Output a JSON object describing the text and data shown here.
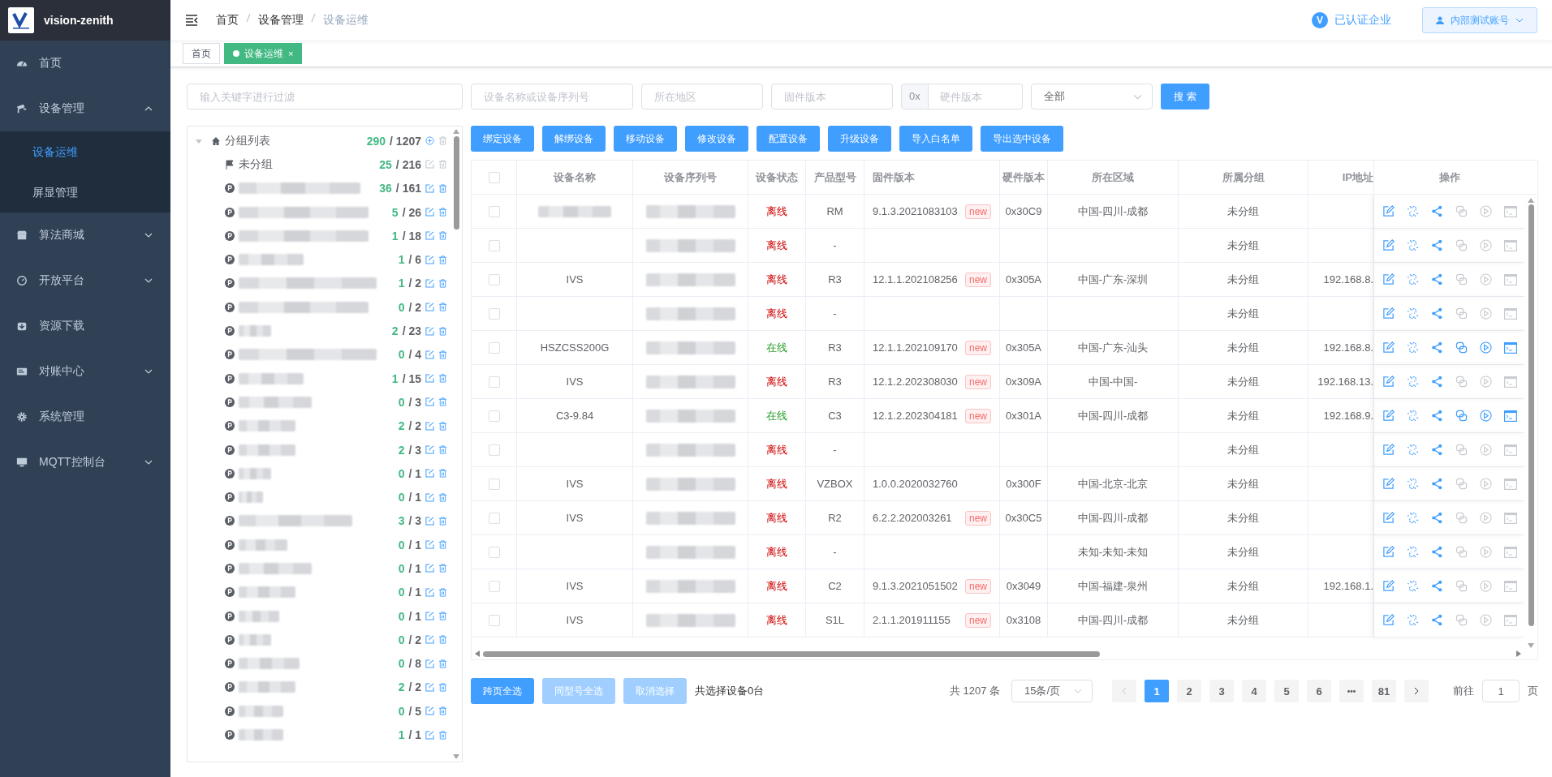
{
  "sidebar": {
    "brand": "vision-zenith",
    "items": [
      {
        "kind": "link",
        "label": "首页"
      },
      {
        "kind": "submenu",
        "label": "设备管理",
        "expanded": true,
        "children": [
          {
            "label": "设备运维",
            "selected": true
          },
          {
            "label": "屏显管理",
            "selected": false
          }
        ]
      },
      {
        "kind": "submenu",
        "label": "算法商城",
        "expanded": false
      },
      {
        "kind": "submenu",
        "label": "开放平台",
        "expanded": false
      },
      {
        "kind": "link",
        "label": "资源下载"
      },
      {
        "kind": "submenu",
        "label": "对账中心",
        "expanded": false
      },
      {
        "kind": "link",
        "label": "系统管理"
      },
      {
        "kind": "submenu",
        "label": "MQTT控制台",
        "expanded": false
      }
    ]
  },
  "header": {
    "breadcrumb": [
      "首页",
      "设备管理",
      "设备运维"
    ],
    "verified": "已认证企业",
    "verified_badge": "V",
    "account": "内部测试账号"
  },
  "tags": [
    {
      "label": "首页",
      "selected": false
    },
    {
      "label": "设备运维",
      "selected": true,
      "close": "×"
    }
  ],
  "filters": {
    "keyword": {
      "placeholder": "输入关键字进行过滤"
    },
    "device": {
      "placeholder": "设备名称或设备序列号"
    },
    "region": {
      "placeholder": "所在地区"
    },
    "firmware": {
      "placeholder": "固件版本"
    },
    "hardware": {
      "prefix": "0x",
      "placeholder": "硬件版本"
    },
    "status": {
      "value": "全部"
    },
    "search": "搜 索"
  },
  "tree": {
    "label": "分组列表",
    "online": "290",
    "total": "/ 1207",
    "expanded": true,
    "children": [
      {
        "kind": "ungrouped",
        "label": "未分组",
        "online": "25",
        "total": "/ 216",
        "disabled": true
      },
      {
        "kind": "group",
        "online": "36",
        "total": "/ 161",
        "disabled": false
      },
      {
        "kind": "group",
        "online": "5",
        "total": "/ 26",
        "disabled": false
      },
      {
        "kind": "group",
        "online": "1",
        "total": "/ 18",
        "disabled": false
      },
      {
        "kind": "group",
        "online": "1",
        "total": "/ 6",
        "disabled": false
      },
      {
        "kind": "group",
        "online": "1",
        "total": "/ 2",
        "disabled": false
      },
      {
        "kind": "group",
        "online": "0",
        "total": "/ 2",
        "disabled": false
      },
      {
        "kind": "group",
        "online": "2",
        "total": "/ 23",
        "disabled": false
      },
      {
        "kind": "group",
        "online": "0",
        "total": "/ 4",
        "disabled": false
      },
      {
        "kind": "group",
        "online": "1",
        "total": "/ 15",
        "disabled": false
      },
      {
        "kind": "group",
        "online": "0",
        "total": "/ 3",
        "disabled": false
      },
      {
        "kind": "group",
        "online": "2",
        "total": "/ 2",
        "disabled": false
      },
      {
        "kind": "group",
        "online": "2",
        "total": "/ 3",
        "disabled": false
      },
      {
        "kind": "group",
        "online": "0",
        "total": "/ 1",
        "disabled": false
      },
      {
        "kind": "group",
        "online": "0",
        "total": "/ 1",
        "disabled": false
      },
      {
        "kind": "group",
        "online": "3",
        "total": "/ 3",
        "disabled": false
      },
      {
        "kind": "group",
        "online": "0",
        "total": "/ 1",
        "disabled": false
      },
      {
        "kind": "group",
        "online": "0",
        "total": "/ 1",
        "disabled": false
      },
      {
        "kind": "group",
        "online": "0",
        "total": "/ 1",
        "disabled": false
      },
      {
        "kind": "group",
        "online": "0",
        "total": "/ 1",
        "disabled": false
      },
      {
        "kind": "group",
        "online": "0",
        "total": "/ 2",
        "disabled": false
      },
      {
        "kind": "group",
        "online": "0",
        "total": "/ 8",
        "disabled": false
      },
      {
        "kind": "group",
        "online": "2",
        "total": "/ 2",
        "disabled": false
      },
      {
        "kind": "group",
        "online": "0",
        "total": "/ 5",
        "disabled": false
      },
      {
        "kind": "group",
        "online": "1",
        "total": "/ 1",
        "disabled": false
      }
    ]
  },
  "actions": [
    "绑定设备",
    "解绑设备",
    "移动设备",
    "修改设备",
    "配置设备",
    "升级设备",
    "导入白名单",
    "导出选中设备"
  ],
  "table": {
    "all_checked": false,
    "columns": [
      "设备名称",
      "设备序列号",
      "设备状态",
      "产品型号",
      "固件版本",
      "硬件版本",
      "所在区域",
      "所属分组",
      "IP地址",
      "操作"
    ],
    "rows": [
      {
        "checked": false,
        "name_redacted": true,
        "status": "离线",
        "online": false,
        "model": "RM",
        "firmware": "9.1.3.2021083103",
        "badge": "new",
        "hardware": "0x30C9",
        "region": "中国-四川-成都",
        "group": "未分组"
      },
      {
        "checked": false,
        "name_redacted": false,
        "status": "离线",
        "online": false,
        "model": "-",
        "group": "未分组"
      },
      {
        "checked": false,
        "name_redacted": false,
        "name": "IVS",
        "status": "离线",
        "online": false,
        "model": "R3",
        "firmware": "12.1.1.202108256",
        "badge": "new",
        "hardware": "0x305A",
        "region": "中国-广东-深圳",
        "group": "未分组",
        "ip": "192.168.8."
      },
      {
        "checked": false,
        "name_redacted": false,
        "status": "离线",
        "online": false,
        "model": "-",
        "group": "未分组"
      },
      {
        "checked": false,
        "name_redacted": false,
        "name": "HSZCSS200G",
        "status": "在线",
        "online": true,
        "model": "R3",
        "firmware": "12.1.1.202109170",
        "badge": "new",
        "hardware": "0x305A",
        "region": "中国-广东-汕头",
        "group": "未分组",
        "ip": "192.168.8."
      },
      {
        "checked": false,
        "name_redacted": false,
        "name": "IVS",
        "status": "离线",
        "online": false,
        "model": "R3",
        "firmware": "12.1.2.202308030",
        "badge": "new",
        "hardware": "0x309A",
        "region": "中国-中国-",
        "group": "未分组",
        "ip": "192.168.13."
      },
      {
        "checked": false,
        "name_redacted": false,
        "name": "C3-9.84",
        "status": "在线",
        "online": true,
        "model": "C3",
        "firmware": "12.1.2.202304181",
        "badge": "new",
        "hardware": "0x301A",
        "region": "中国-四川-成都",
        "group": "未分组",
        "ip": "192.168.9."
      },
      {
        "checked": false,
        "name_redacted": false,
        "status": "离线",
        "online": false,
        "model": "-",
        "group": "未分组"
      },
      {
        "checked": false,
        "name_redacted": false,
        "name": "IVS",
        "status": "离线",
        "online": false,
        "model": "VZBOX",
        "firmware": "1.0.0.2020032760",
        "hardware": "0x300F",
        "region": "中国-北京-北京",
        "group": "未分组"
      },
      {
        "checked": false,
        "name_redacted": false,
        "name": "IVS",
        "status": "离线",
        "online": false,
        "model": "R2",
        "firmware": "6.2.2.202003261",
        "badge": "new",
        "hardware": "0x30C5",
        "region": "中国-四川-成都",
        "group": "未分组"
      },
      {
        "checked": false,
        "name_redacted": false,
        "status": "离线",
        "online": false,
        "model": "-",
        "region": "未知-未知-未知",
        "group": "未分组"
      },
      {
        "checked": false,
        "name_redacted": false,
        "name": "IVS",
        "status": "离线",
        "online": false,
        "model": "C2",
        "firmware": "9.1.3.2021051502",
        "badge": "new",
        "hardware": "0x3049",
        "region": "中国-福建-泉州",
        "group": "未分组",
        "ip": "192.168.1."
      },
      {
        "checked": false,
        "name_redacted": false,
        "name": "IVS",
        "status": "离线",
        "online": false,
        "model": "S1L",
        "firmware": "2.1.1.201911155",
        "badge": "new",
        "hardware": "0x3108",
        "region": "中国-四川-成都",
        "group": "未分组"
      }
    ]
  },
  "footer": {
    "buttons": [
      {
        "label": "跨页全选",
        "disabled": false
      },
      {
        "label": "同型号全选",
        "disabled": true
      },
      {
        "label": "取消选择",
        "disabled": true
      }
    ],
    "selected_info": "共选择设备0台"
  },
  "pagination": {
    "total": "共 1207 条",
    "page_size": "15条/页",
    "prev_disabled": true,
    "pages": [
      {
        "kind": "page",
        "label": "1",
        "selected": true
      },
      {
        "kind": "page",
        "label": "2",
        "selected": false
      },
      {
        "kind": "page",
        "label": "3",
        "selected": false
      },
      {
        "kind": "page",
        "label": "4",
        "selected": false
      },
      {
        "kind": "page",
        "label": "5",
        "selected": false
      },
      {
        "kind": "page",
        "label": "6",
        "selected": false
      },
      {
        "kind": "more",
        "label": "•••",
        "selected": false
      },
      {
        "kind": "page",
        "label": "81",
        "selected": false
      }
    ],
    "goto_label": "前往",
    "goto_value": "1",
    "goto_suffix": "页"
  }
}
